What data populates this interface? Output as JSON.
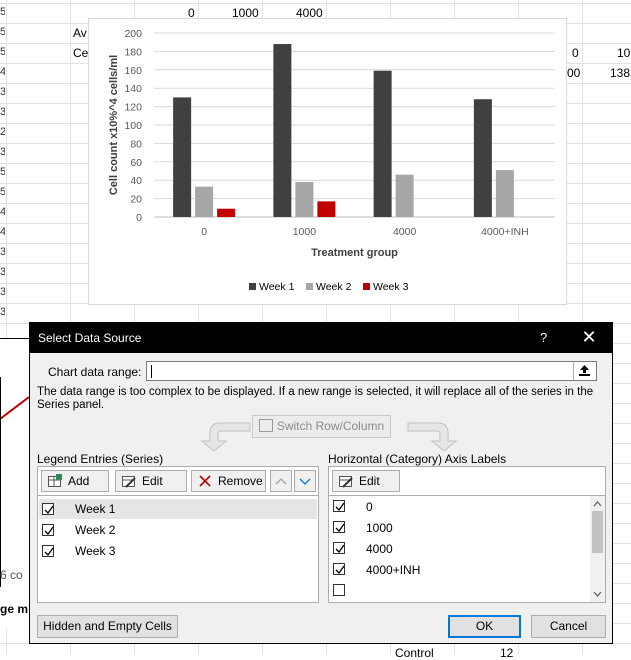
{
  "spreadsheet": {
    "top_row_values": [
      "0",
      "1000",
      "4000"
    ],
    "cell_av": "Av",
    "cell_ce": "Ce",
    "cell_r2a": "0",
    "cell_r2b": "10",
    "cell_r3a": "00",
    "cell_r3b": "138",
    "row_fragments": [
      "5",
      "5",
      "5",
      "4",
      "3",
      "3",
      "2",
      "3",
      "5",
      "5",
      "4",
      "4",
      "3",
      "3",
      "3",
      "3"
    ],
    "bottom_left_text": "6 co",
    "bottom_left_bold": "ge m",
    "bottom_control": "Control",
    "bottom_twelve": "12"
  },
  "chart_data": {
    "type": "bar",
    "categories": [
      "0",
      "1000",
      "4000",
      "4000+INH"
    ],
    "series": [
      {
        "name": "Week 1",
        "values": [
          130,
          188,
          159,
          128
        ],
        "color": "#404040"
      },
      {
        "name": "Week 2",
        "values": [
          33,
          38,
          46,
          51
        ],
        "color": "#a6a6a6"
      },
      {
        "name": "Week 3",
        "values": [
          9,
          17,
          null,
          null
        ],
        "color": "#c00000"
      }
    ],
    "xlabel": "Treatment group",
    "ylabel": "Cell count x10%^4 cells/ml",
    "ylim": [
      0,
      200
    ],
    "yticks": [
      "0",
      "20",
      "40",
      "60",
      "80",
      "100",
      "120",
      "140",
      "160",
      "180",
      "200"
    ],
    "grid": true,
    "legend": "bottom"
  },
  "dialog": {
    "title": "Select Data Source",
    "help": "?",
    "close": "✕",
    "chart_range_label": "Chart data range:",
    "chart_range_value": "",
    "message": "The data range is too complex to be displayed. If a new range is selected, it will replace all of the series in the Series panel.",
    "switch_label": "Switch Row/Column",
    "legend_header": "Legend Entries (Series)",
    "axis_header": "Horizontal (Category) Axis Labels",
    "add_label": "Add",
    "edit_label": "Edit",
    "remove_label": "Remove",
    "axis_edit_label": "Edit",
    "series_items": [
      "Week 1",
      "Week 2",
      "Week 3"
    ],
    "axis_items": [
      "0",
      "1000",
      "4000",
      "4000+INH",
      ""
    ],
    "hidden_cells_label": "Hidden and Empty Cells",
    "ok_label": "OK",
    "cancel_label": "Cancel"
  }
}
